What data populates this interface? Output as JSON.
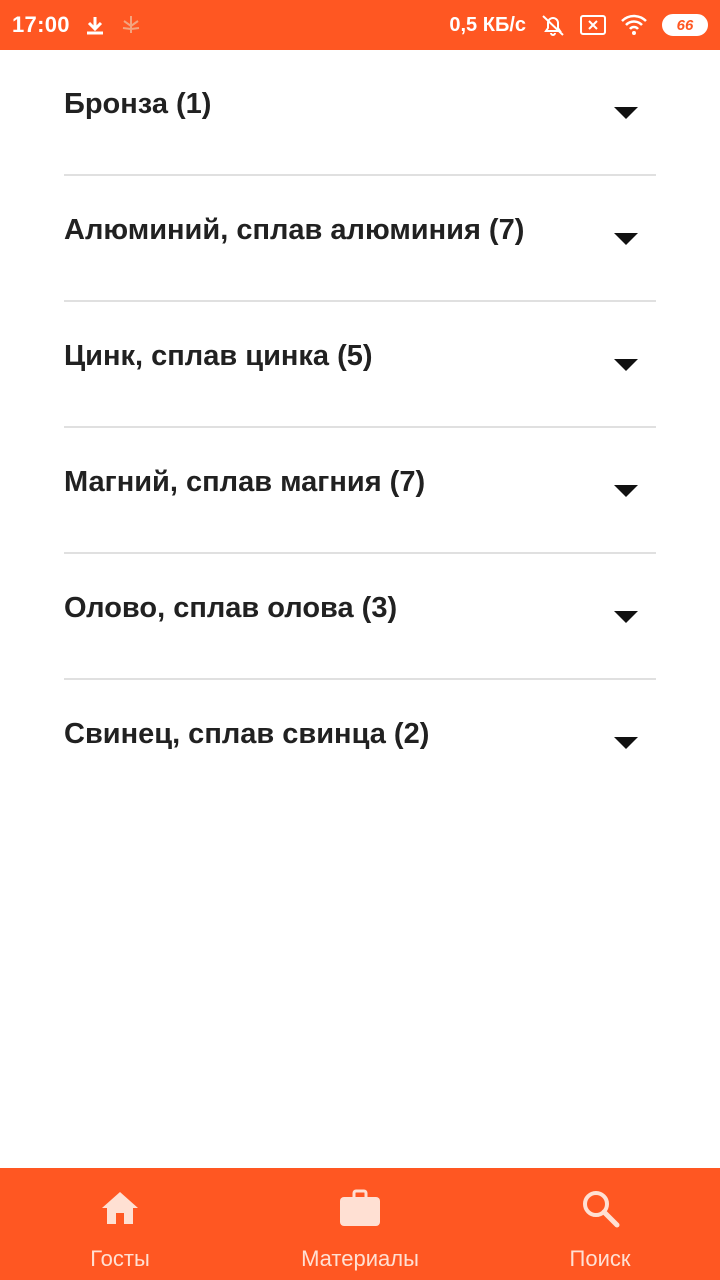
{
  "status_bar": {
    "time": "17:00",
    "net_speed": "0,5 КБ/с",
    "battery": "66",
    "icons": [
      "download-icon",
      "cannabis-notification-icon",
      "alarm-off-icon",
      "sim-off-icon",
      "wifi-icon",
      "battery-icon"
    ]
  },
  "list": {
    "items": [
      {
        "label": "Бронза (1)"
      },
      {
        "label": "Алюминий, сплав алюминия (7)"
      },
      {
        "label": "Цинк, сплав цинка (5)"
      },
      {
        "label": "Магний, сплав магния (7)"
      },
      {
        "label": "Олово, сплав олова (3)"
      },
      {
        "label": "Свинец, сплав свинца (2)"
      }
    ]
  },
  "bottom_nav": {
    "items": [
      {
        "label": "Госты",
        "icon": "home-icon"
      },
      {
        "label": "Материалы",
        "icon": "briefcase-icon"
      },
      {
        "label": "Поиск",
        "icon": "search-icon"
      }
    ]
  },
  "colors": {
    "accent": "#ff5722",
    "nav_label": "#ffe0d3",
    "text": "#212121",
    "divider": "#e0e0e0"
  }
}
